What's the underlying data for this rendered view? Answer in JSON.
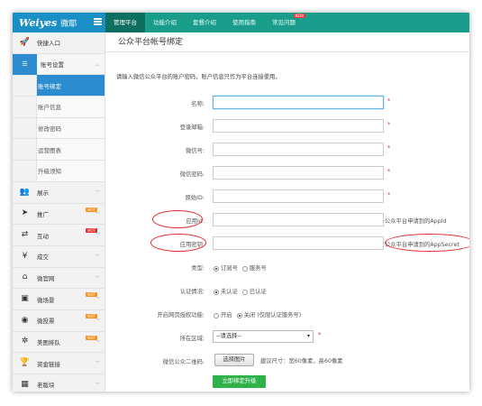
{
  "app": {
    "logo_mark": "Weiyes",
    "logo_cn": "微耶"
  },
  "topnav": {
    "tabs": [
      {
        "label": "管理平台",
        "active": true
      },
      {
        "label": "功能介绍",
        "active": false
      },
      {
        "label": "套餐介绍",
        "active": false
      },
      {
        "label": "使用指南",
        "active": false
      },
      {
        "label": "常见问题",
        "active": false,
        "badge": "NEW"
      }
    ]
  },
  "sidebar": {
    "items": [
      {
        "label": "快捷入口",
        "icon": "rocket-icon",
        "glyph": "🚀"
      },
      {
        "label": "账号设置",
        "icon": "list-icon",
        "glyph": "☰",
        "expanded": true
      },
      {
        "label": "展示",
        "icon": "users-icon",
        "glyph": "👥"
      },
      {
        "label": "推广",
        "icon": "send-icon",
        "glyph": "➤",
        "hot": "HOT"
      },
      {
        "label": "互动",
        "icon": "shuffle-icon",
        "glyph": "⇄",
        "hot": "HOT"
      },
      {
        "label": "成交",
        "icon": "yen-icon",
        "glyph": "¥"
      },
      {
        "label": "微官网",
        "icon": "home-icon",
        "glyph": "⌂"
      },
      {
        "label": "微场景",
        "icon": "picture-icon",
        "glyph": "▣",
        "hot": "HOT"
      },
      {
        "label": "微投票",
        "icon": "globe-icon",
        "glyph": "◉",
        "hot": "HOT"
      },
      {
        "label": "美图排队",
        "icon": "spinner-icon",
        "glyph": "✲",
        "hot": "HOT"
      },
      {
        "label": "资金链接",
        "icon": "trophy-icon",
        "glyph": "🏆"
      },
      {
        "label": "老版块",
        "icon": "film-icon",
        "glyph": "▦"
      }
    ],
    "sub_items": [
      {
        "label": "账号绑定",
        "active": true
      },
      {
        "label": "账户信息",
        "active": false
      },
      {
        "label": "修改密码",
        "active": false
      },
      {
        "label": "运营图表",
        "active": false
      },
      {
        "label": "升级须知",
        "active": false
      }
    ]
  },
  "main": {
    "title": "公众平台帐号绑定",
    "description": "请输入微信公众平台的账户密码，账户信息只作为平台连接使用。",
    "fields": [
      {
        "label": "名称:",
        "value": "",
        "required": true,
        "hint": ""
      },
      {
        "label": "登录邮箱:",
        "value": "",
        "required": true,
        "hint": ""
      },
      {
        "label": "微信号:",
        "value": "",
        "required": true,
        "hint": ""
      },
      {
        "label": "微信密码:",
        "value": "",
        "required": true,
        "hint": ""
      },
      {
        "label": "原始ID:",
        "value": "",
        "required": true,
        "hint": ""
      },
      {
        "label": "应用Id:",
        "value": "",
        "required": false,
        "hint": "公众平台申请到的AppId"
      },
      {
        "label": "应用密钥:",
        "value": "",
        "required": false,
        "hint": "公众平台申请到的AppSecret"
      }
    ],
    "type_row": {
      "label": "类型:",
      "options": [
        "订阅号",
        "服务号"
      ],
      "selected": 0
    },
    "verify_row": {
      "label": "认证情况:",
      "options": [
        "未认证",
        "已认证"
      ],
      "selected": 0
    },
    "oauth_row": {
      "label": "开启网页授权功能:",
      "options": [
        "开启",
        "关闭 (仅限认证服务号)"
      ],
      "selected": 1
    },
    "region_row": {
      "label": "所在区域:",
      "value": "--请选择--",
      "required": true
    },
    "qr_row": {
      "label": "微信公众二维码:",
      "button": "选择图片",
      "hint": "建议尺寸：宽60像素，高60像素"
    },
    "submit": "立即绑定升级"
  },
  "colors": {
    "topbar": "#1a9c8a",
    "logo_bg": "#1a8fc6",
    "active_sub": "#2d8ccf",
    "submit": "#2fb24a",
    "annotation": "#e62424"
  }
}
